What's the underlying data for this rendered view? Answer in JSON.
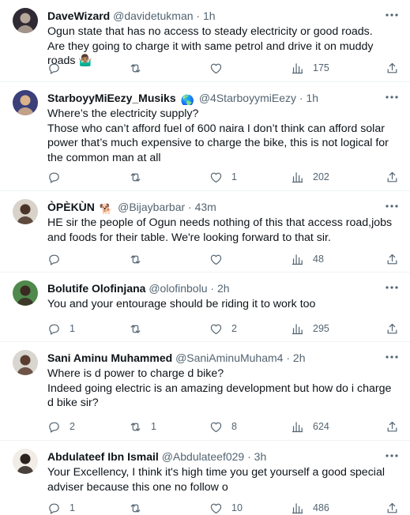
{
  "tweets": [
    {
      "name": "DaveWizard",
      "handle": "@davidetukman",
      "time": "1h",
      "emoji": "",
      "body": "Ogun state that has no access to steady electricity or good roads.\nAre they going to charge it with same petrol and drive it on muddy roads 🤷🏽‍♂️",
      "replies": "",
      "retweets": "",
      "likes": "",
      "views": "175",
      "avatar_colors": [
        "#2f2a33",
        "#b7a79a"
      ]
    },
    {
      "name": "StarboyyMiEezy_Musiks",
      "handle": "@4StarboyymiEezy",
      "time": "1h",
      "emoji": "🌎",
      "body": "Where’s the electricity supply?\nThose who can’t afford fuel of 600 naira I don’t think can afford solar power that’s much expensive to charge the bike, this is not logical for the common man at all",
      "replies": "",
      "retweets": "",
      "likes": "1",
      "views": "202",
      "avatar_colors": [
        "#3b3f7a",
        "#d9b38a"
      ]
    },
    {
      "name": "ÒPÈKÙN",
      "handle": "@Bijaybarbar",
      "time": "43m",
      "emoji": "🐕",
      "body": "HE sir the people of Ogun needs nothing of this that access road,jobs and foods for their table. We're looking forward to that sir.",
      "replies": "",
      "retweets": "",
      "likes": "",
      "views": "48",
      "avatar_colors": [
        "#d8d2c9",
        "#4a3328"
      ]
    },
    {
      "name": "Bolutife Olofinjana",
      "handle": "@olofinbolu",
      "time": "2h",
      "emoji": "",
      "body": "You and your entourage should be riding it to work too",
      "replies": "1",
      "retweets": "",
      "likes": "2",
      "views": "295",
      "avatar_colors": [
        "#4f8a4c",
        "#3a2a22"
      ]
    },
    {
      "name": "Sani Aminu Muhammed",
      "handle": "@SaniAminuMuham4",
      "time": "2h",
      "emoji": "",
      "body": "Where is d power to charge d bike?\nIndeed going electric is an amazing development but how do i charge d bike sir?",
      "replies": "2",
      "retweets": "1",
      "likes": "8",
      "views": "624",
      "avatar_colors": [
        "#d9d5cf",
        "#5a3d2f"
      ]
    },
    {
      "name": "Abdulateef Ibn Ismail",
      "handle": "@Abdulateef029",
      "time": "3h",
      "emoji": "",
      "body": "Your Excellency, I think it's high time you get yourself a good special adviser because this one no follow o",
      "replies": "1",
      "retweets": "",
      "likes": "10",
      "views": "486",
      "avatar_colors": [
        "#f1ede6",
        "#2b211d"
      ]
    }
  ],
  "icons": {
    "more": "more-icon",
    "reply": "reply-icon",
    "retweet": "retweet-icon",
    "like": "like-icon",
    "views": "views-icon",
    "share": "share-icon"
  },
  "colors": {
    "text": "#0f1419",
    "muted": "#536471",
    "divider": "#eff3f4"
  }
}
